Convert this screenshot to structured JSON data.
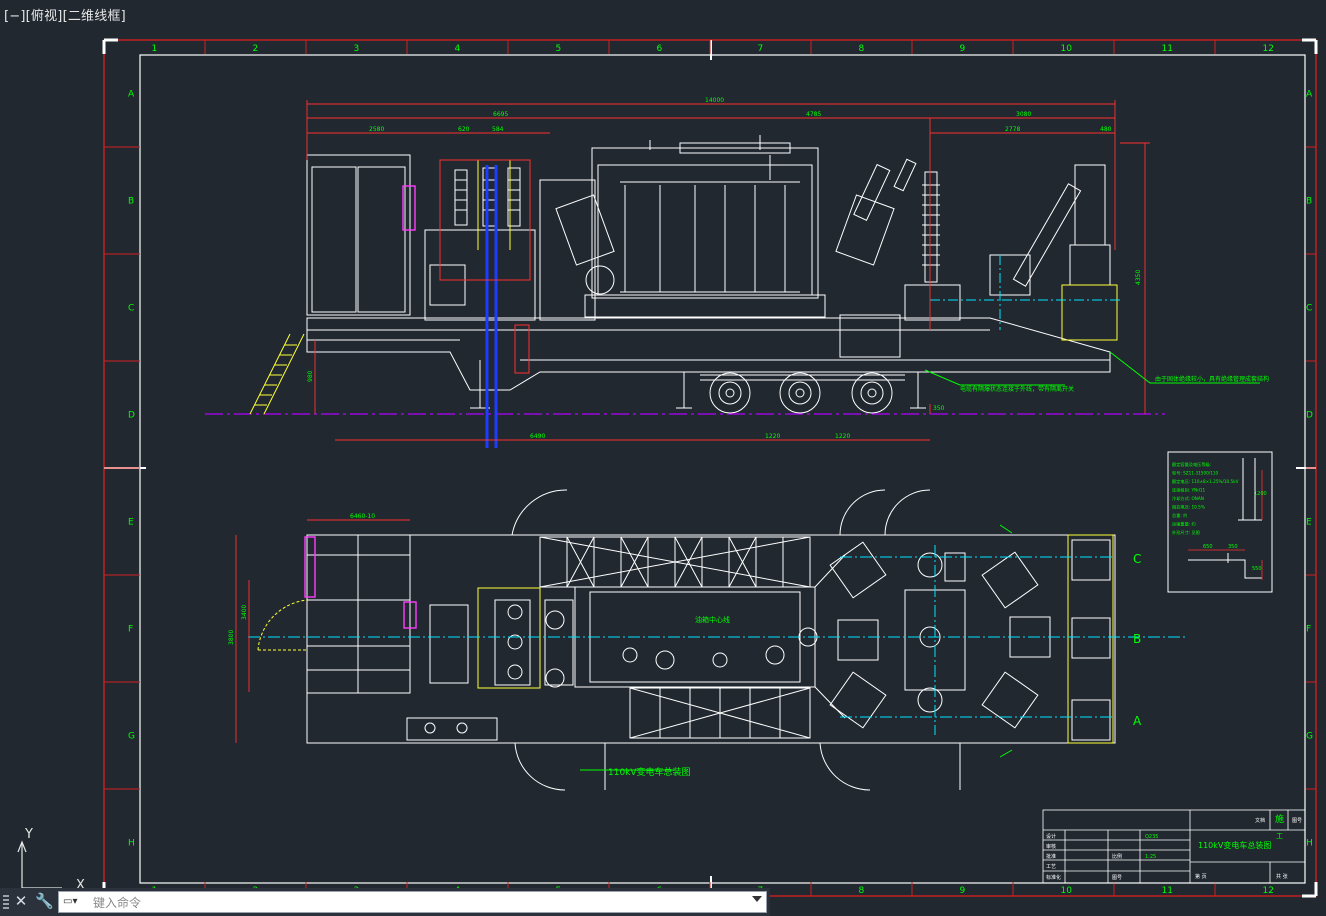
{
  "viewport": {
    "label": "[−][俯视][二维线框]"
  },
  "frame": {
    "columns": [
      "1",
      "2",
      "3",
      "4",
      "5",
      "6",
      "7",
      "8",
      "9",
      "10",
      "11",
      "12"
    ],
    "rows": [
      "A",
      "B",
      "C",
      "D",
      "E",
      "F",
      "G",
      "H"
    ]
  },
  "elevation": {
    "dims": {
      "overall": "14000",
      "left_span": "6695",
      "right_span": "4785",
      "right_upper": "3080",
      "sub_a": "2580",
      "sub_b": "620",
      "sub_c": "584",
      "sub_d": "2778",
      "sub_e": "480",
      "height": "4350",
      "ground": "980",
      "axle_a": "6490",
      "axle_b": "1220",
      "axle_c": "1220",
      "clear": "350"
    },
    "notes": {
      "right": "由于固体绝缘较小，具有绝缘管理成套结构",
      "middle": "电缆有隔爆状态连接于外线，带有隔离开关"
    }
  },
  "plan": {
    "dims": {
      "width": "6460-10",
      "depth_a": "3800",
      "depth_b": "3400"
    },
    "center_label": "油箱中心线",
    "phases": [
      "C",
      "B",
      "A"
    ],
    "title": "110kV变电车总装图"
  },
  "detail": {
    "lines": [
      "额定容量及电压等级:",
      "型号: SZ11-31500/110",
      "额定电压: 110±8×1.25%/10.5kV",
      "连接组别: YNd11",
      "冷却方式: ONAN",
      "阻抗电压: 10.5%",
      "总重: 约",
      "运输重量: 约",
      "外形尺寸: 见图"
    ],
    "dims": {
      "h": "1200",
      "w1": "650",
      "w2": "350",
      "v": "550"
    }
  },
  "title_block": {
    "title": "110kV变电车总装图",
    "code_label": "图号",
    "scale_label": "比例",
    "design": "设计",
    "check": "审核",
    "approve": "批准",
    "proc": "工艺",
    "std": "标准化",
    "sheet": "第 页",
    "total": "共 张",
    "stamp_a": "文档",
    "stamp_b": "施",
    "stamp_c": "图号",
    "stamp_d": "工",
    "scale_val": "1:25",
    "mat_val": "Q235"
  },
  "ucs": {
    "y": "Y",
    "x": "X"
  },
  "command": {
    "placeholder": "键入命令"
  },
  "colors": {
    "background": "#212830",
    "frame": "#d02020",
    "geometry": "#ffffff",
    "dimension": "#ff3030",
    "text": "#00ff00",
    "center": "#00e5ff",
    "ground": "#b000ff",
    "cable": "#1e3cff",
    "accent": "#ffff33",
    "magenta": "#ff3cff"
  }
}
